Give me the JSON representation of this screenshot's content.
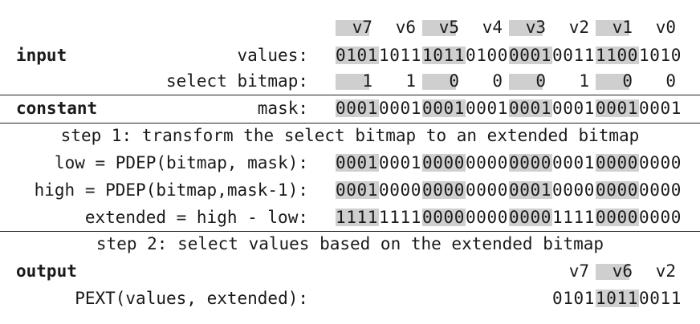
{
  "lane_labels": [
    "v7",
    "v6",
    "v5",
    "v4",
    "v3",
    "v2",
    "v1",
    "v0"
  ],
  "lane_shaded": [
    true,
    false,
    true,
    false,
    true,
    false,
    true,
    false
  ],
  "input_label": "input",
  "values_desc": "values:",
  "values_bits": [
    "0101",
    "1011",
    "1011",
    "0100",
    "0001",
    "0011",
    "1100",
    "1010"
  ],
  "select_desc": "select bitmap:",
  "select_bits": [
    "1",
    "1",
    "0",
    "0",
    "0",
    "1",
    "0",
    "0"
  ],
  "constant_label": "constant",
  "mask_desc": "mask:",
  "mask_bits": [
    "0001",
    "0001",
    "0001",
    "0001",
    "0001",
    "0001",
    "0001",
    "0001"
  ],
  "step1": "step 1: transform the select bitmap to an extended bitmap",
  "low_desc": "low = PDEP(bitmap, mask):",
  "low_bits": [
    "0001",
    "0001",
    "0000",
    "0000",
    "0000",
    "0001",
    "0000",
    "0000"
  ],
  "high_desc": "high = PDEP(bitmap,mask-1):",
  "high_bits": [
    "0001",
    "0000",
    "0000",
    "0000",
    "0001",
    "0000",
    "0000",
    "0000"
  ],
  "ext_desc": "extended = high - low:",
  "ext_bits": [
    "1111",
    "1111",
    "0000",
    "0000",
    "0000",
    "1111",
    "0000",
    "0000"
  ],
  "step2": "step 2: select values based on the extended bitmap",
  "output_label": "output",
  "out_lanes": [
    "v7",
    "v6",
    "v2"
  ],
  "pext_desc": "PEXT(values, extended):",
  "pext_bits": [
    "0101",
    "1011",
    "0011"
  ],
  "highlight_color": "#cfcfcf"
}
